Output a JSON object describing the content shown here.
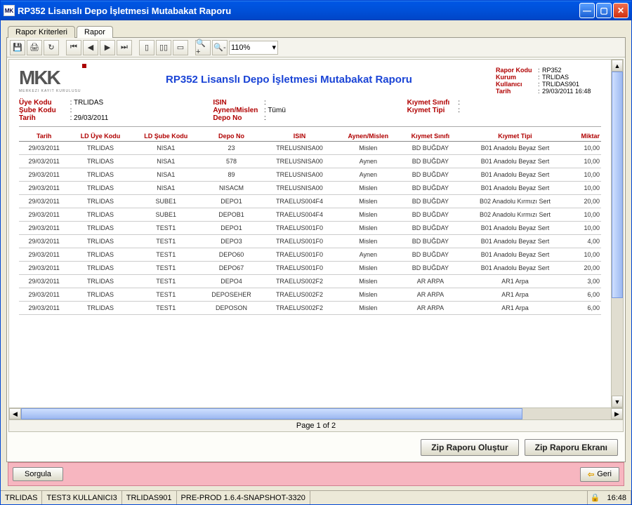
{
  "window": {
    "title": "RP352 Lisanslı Depo İşletmesi Mutabakat Raporu"
  },
  "tabs": {
    "t0": "Rapor Kriterleri",
    "t1": "Rapor"
  },
  "toolbar": {
    "zoom": "110%"
  },
  "report": {
    "title": "RP352 Lisanslı Depo İşletmesi Mutabakat Raporu",
    "meta": {
      "rapor_kodu_l": "Rapor Kodu",
      "rapor_kodu_v": "RP352",
      "kurum_l": "Kurum",
      "kurum_v": "TRLIDAS",
      "kullanici_l": "Kullanıcı",
      "kullanici_v": "TRLIDAS901",
      "tarih_l": "Tarih",
      "tarih_v": "29/03/2011 16:48"
    },
    "filters": {
      "uye_kodu_l": "Üye Kodu",
      "uye_kodu_v": "TRLIDAS",
      "sube_kodu_l": "Şube Kodu",
      "sube_kodu_v": "",
      "tarih_l": "Tarih",
      "tarih_v": "29/03/2011",
      "isin_l": "ISIN",
      "isin_v": "",
      "aynen_l": "Aynen/Mislen",
      "aynen_v": "Tümü",
      "depo_l": "Depo No",
      "depo_v": "",
      "ks_l": "Kıymet Sınıfı",
      "ks_v": "",
      "kt_l": "Kıymet Tipi",
      "kt_v": ""
    },
    "cols": {
      "c0": "Tarih",
      "c1": "LD Üye Kodu",
      "c2": "LD Şube Kodu",
      "c3": "Depo No",
      "c4": "ISIN",
      "c5": "Aynen/Mislen",
      "c6": "Kıymet Sınıfı",
      "c7": "Kıymet Tipi",
      "c8": "Miktar"
    },
    "rows": [
      {
        "c0": "29/03/2011",
        "c1": "TRLIDAS",
        "c2": "NISA1",
        "c3": "23",
        "c4": "TRELUSNISA00",
        "c5": "Mislen",
        "c6": "BD BUĞDAY",
        "c7": "B01 Anadolu Beyaz Sert",
        "c8": "10,00"
      },
      {
        "c0": "29/03/2011",
        "c1": "TRLIDAS",
        "c2": "NISA1",
        "c3": "578",
        "c4": "TRELUSNISA00",
        "c5": "Aynen",
        "c6": "BD BUĞDAY",
        "c7": "B01 Anadolu Beyaz Sert",
        "c8": "10,00"
      },
      {
        "c0": "29/03/2011",
        "c1": "TRLIDAS",
        "c2": "NISA1",
        "c3": "89",
        "c4": "TRELUSNISA00",
        "c5": "Aynen",
        "c6": "BD BUĞDAY",
        "c7": "B01 Anadolu Beyaz Sert",
        "c8": "10,00"
      },
      {
        "c0": "29/03/2011",
        "c1": "TRLIDAS",
        "c2": "NISA1",
        "c3": "NISACM",
        "c4": "TRELUSNISA00",
        "c5": "Mislen",
        "c6": "BD BUĞDAY",
        "c7": "B01 Anadolu Beyaz Sert",
        "c8": "10,00"
      },
      {
        "c0": "29/03/2011",
        "c1": "TRLIDAS",
        "c2": "SUBE1",
        "c3": "DEPO1",
        "c4": "TRAELUS004F4",
        "c5": "Mislen",
        "c6": "BD BUĞDAY",
        "c7": "B02 Anadolu Kırmızı Sert",
        "c8": "20,00"
      },
      {
        "c0": "29/03/2011",
        "c1": "TRLIDAS",
        "c2": "SUBE1",
        "c3": "DEPOB1",
        "c4": "TRAELUS004F4",
        "c5": "Mislen",
        "c6": "BD BUĞDAY",
        "c7": "B02 Anadolu Kırmızı Sert",
        "c8": "10,00"
      },
      {
        "c0": "29/03/2011",
        "c1": "TRLIDAS",
        "c2": "TEST1",
        "c3": "DEPO1",
        "c4": "TRAELUS001F0",
        "c5": "Mislen",
        "c6": "BD BUĞDAY",
        "c7": "B01 Anadolu Beyaz Sert",
        "c8": "10,00"
      },
      {
        "c0": "29/03/2011",
        "c1": "TRLIDAS",
        "c2": "TEST1",
        "c3": "DEPO3",
        "c4": "TRAELUS001F0",
        "c5": "Mislen",
        "c6": "BD BUĞDAY",
        "c7": "B01 Anadolu Beyaz Sert",
        "c8": "4,00"
      },
      {
        "c0": "29/03/2011",
        "c1": "TRLIDAS",
        "c2": "TEST1",
        "c3": "DEPO60",
        "c4": "TRAELUS001F0",
        "c5": "Aynen",
        "c6": "BD BUĞDAY",
        "c7": "B01 Anadolu Beyaz Sert",
        "c8": "10,00"
      },
      {
        "c0": "29/03/2011",
        "c1": "TRLIDAS",
        "c2": "TEST1",
        "c3": "DEPO67",
        "c4": "TRAELUS001F0",
        "c5": "Mislen",
        "c6": "BD BUĞDAY",
        "c7": "B01 Anadolu Beyaz Sert",
        "c8": "20,00"
      },
      {
        "c0": "29/03/2011",
        "c1": "TRLIDAS",
        "c2": "TEST1",
        "c3": "DEPO4",
        "c4": "TRAELUS002F2",
        "c5": "Mislen",
        "c6": "AR ARPA",
        "c7": "AR1 Arpa",
        "c8": "3,00"
      },
      {
        "c0": "29/03/2011",
        "c1": "TRLIDAS",
        "c2": "TEST1",
        "c3": "DEPOSEHER",
        "c4": "TRAELUS002F2",
        "c5": "Mislen",
        "c6": "AR ARPA",
        "c7": "AR1 Arpa",
        "c8": "6,00"
      },
      {
        "c0": "29/03/2011",
        "c1": "TRLIDAS",
        "c2": "TEST1",
        "c3": "DEPOSON",
        "c4": "TRAELUS002F2",
        "c5": "Mislen",
        "c6": "AR ARPA",
        "c7": "AR1 Arpa",
        "c8": "6,00"
      }
    ],
    "pager": "Page 1 of 2"
  },
  "buttons": {
    "zip_olustur": "Zip Raporu Oluştur",
    "zip_ekran": "Zip Raporu Ekranı",
    "sorgula": "Sorgula",
    "geri": "Geri"
  },
  "status": {
    "s0": "TRLIDAS",
    "s1": "TEST3 KULLANICI3",
    "s2": "TRLIDAS901",
    "s3": "PRE-PROD 1.6.4-SNAPSHOT-3320",
    "clock": "16:48"
  }
}
